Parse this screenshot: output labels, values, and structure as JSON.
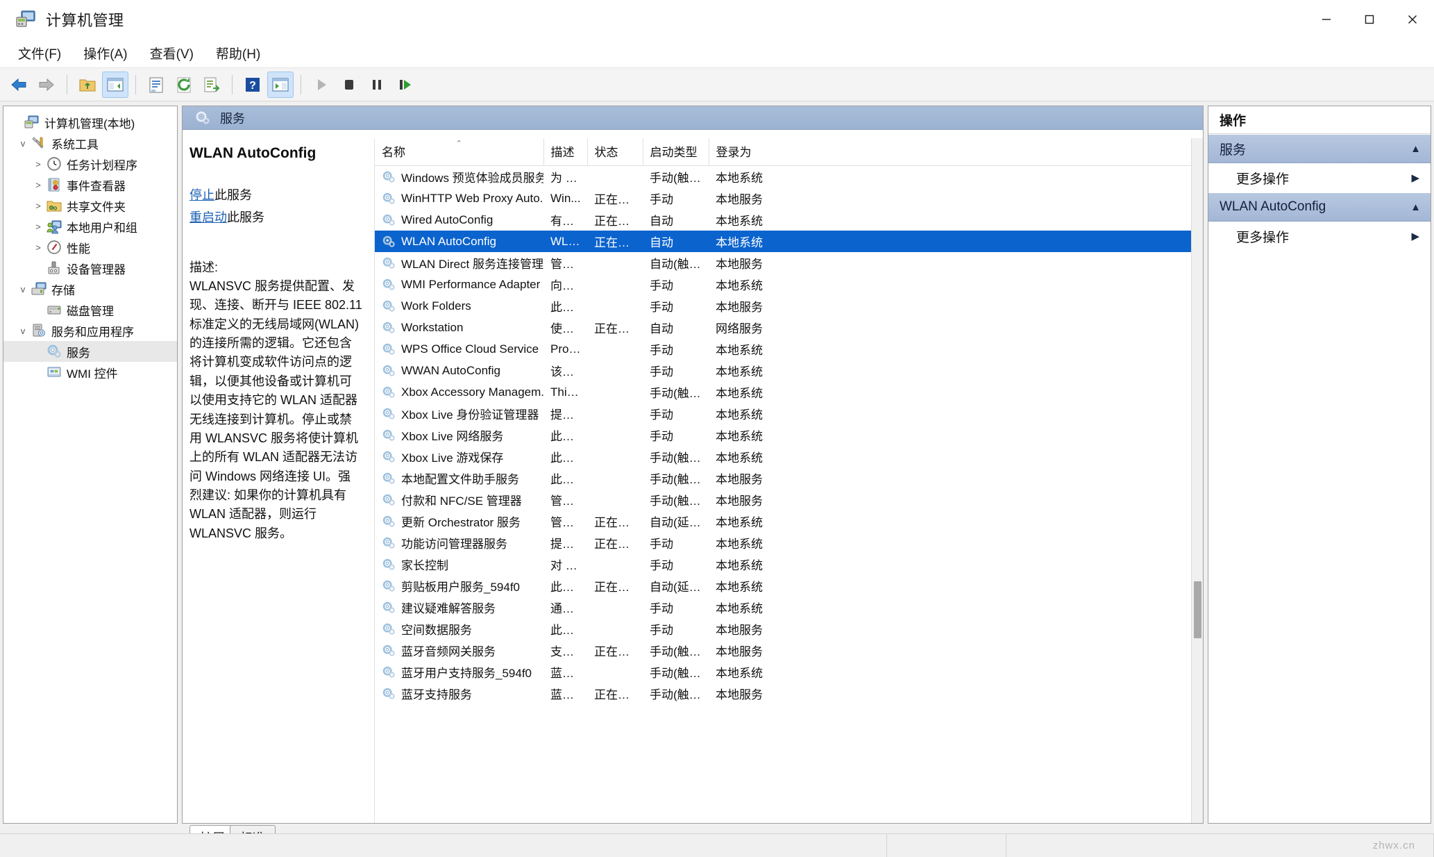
{
  "window": {
    "title": "计算机管理",
    "app_icon": "computer-management-icon",
    "controls": {
      "minimize": "—",
      "maximize": "□",
      "close": "✕"
    }
  },
  "menubar": {
    "items": [
      {
        "label": "文件(F)",
        "name": "menu-file"
      },
      {
        "label": "操作(A)",
        "name": "menu-action"
      },
      {
        "label": "查看(V)",
        "name": "menu-view"
      },
      {
        "label": "帮助(H)",
        "name": "menu-help"
      }
    ]
  },
  "toolbar": {
    "buttons": [
      {
        "name": "back-button",
        "icon": "back-arrow-icon",
        "active": false
      },
      {
        "name": "forward-button",
        "icon": "forward-arrow-icon",
        "active": false
      },
      {
        "name": "up-one-level-button",
        "icon": "folder-up-icon",
        "active": false
      },
      {
        "name": "show-hide-console-tree-button",
        "icon": "console-tree-icon",
        "active": true
      },
      {
        "name": "properties-button",
        "icon": "properties-icon",
        "active": false
      },
      {
        "name": "refresh-button",
        "icon": "refresh-icon",
        "active": false
      },
      {
        "name": "export-list-button",
        "icon": "export-list-icon",
        "active": false
      },
      {
        "name": "help-button",
        "icon": "help-question-icon",
        "active": false
      },
      {
        "name": "show-action-pane-button",
        "icon": "action-pane-icon",
        "active": true
      },
      {
        "name": "start-service-button",
        "icon": "play-icon",
        "active": false
      },
      {
        "name": "stop-service-button",
        "icon": "stop-icon",
        "active": false
      },
      {
        "name": "pause-service-button",
        "icon": "pause-icon",
        "active": false
      },
      {
        "name": "restart-service-button",
        "icon": "restart-icon",
        "active": false
      }
    ]
  },
  "tree": {
    "items": [
      {
        "label": "计算机管理(本地)",
        "indent": 0,
        "chevron": "",
        "icon": "computer-icon",
        "selected": false
      },
      {
        "label": "系统工具",
        "indent": 1,
        "chevron": "v",
        "icon": "tools-icon",
        "selected": false
      },
      {
        "label": "任务计划程序",
        "indent": 2,
        "chevron": ">",
        "icon": "clock-icon",
        "selected": false
      },
      {
        "label": "事件查看器",
        "indent": 2,
        "chevron": ">",
        "icon": "event-viewer-icon",
        "selected": false
      },
      {
        "label": "共享文件夹",
        "indent": 2,
        "chevron": ">",
        "icon": "shared-folder-icon",
        "selected": false
      },
      {
        "label": "本地用户和组",
        "indent": 2,
        "chevron": ">",
        "icon": "users-groups-icon",
        "selected": false
      },
      {
        "label": "性能",
        "indent": 2,
        "chevron": ">",
        "icon": "performance-icon",
        "selected": false
      },
      {
        "label": "设备管理器",
        "indent": 2,
        "chevron": "",
        "icon": "device-manager-icon",
        "selected": false
      },
      {
        "label": "存储",
        "indent": 1,
        "chevron": "v",
        "icon": "storage-icon",
        "selected": false
      },
      {
        "label": "磁盘管理",
        "indent": 2,
        "chevron": "",
        "icon": "disk-management-icon",
        "selected": false
      },
      {
        "label": "服务和应用程序",
        "indent": 1,
        "chevron": "v",
        "icon": "services-apps-icon",
        "selected": false
      },
      {
        "label": "服务",
        "indent": 2,
        "chevron": "",
        "icon": "gear-icon",
        "selected": true
      },
      {
        "label": "WMI 控件",
        "indent": 2,
        "chevron": "",
        "icon": "wmi-control-icon",
        "selected": false
      }
    ]
  },
  "mid": {
    "banner_title": "服务",
    "banner_icon": "gear-icon",
    "detail": {
      "service_name": "WLAN AutoConfig",
      "stop_link": "停止",
      "stop_suffix": "此服务",
      "restart_link": "重启动",
      "restart_suffix": "此服务",
      "description_label": "描述:",
      "description": "WLANSVC 服务提供配置、发现、连接、断开与 IEEE 802.11 标准定义的无线局域网(WLAN)的连接所需的逻辑。它还包含将计算机变成软件访问点的逻辑，以便其他设备或计算机可以使用支持它的 WLAN 适配器无线连接到计算机。停止或禁用 WLANSVC 服务将使计算机上的所有 WLAN 适配器无法访问 Windows 网络连接 UI。强烈建议: 如果你的计算机具有 WLAN 适配器，则运行 WLANSVC 服务。"
    },
    "table": {
      "columns": [
        {
          "label": "名称",
          "name": "column-header-name",
          "sorted": true
        },
        {
          "label": "描述",
          "name": "column-header-description",
          "sorted": false
        },
        {
          "label": "状态",
          "name": "column-header-status",
          "sorted": false
        },
        {
          "label": "启动类型",
          "name": "column-header-startup-type",
          "sorted": false
        },
        {
          "label": "登录为",
          "name": "column-header-log-on-as",
          "sorted": false
        }
      ],
      "sort_caret": "⌃",
      "rows": [
        {
          "name": "Windows 预览体验成员服务",
          "desc": "为 W...",
          "status": "",
          "startup": "手动(触发...",
          "logon": "本地系统",
          "selected": false
        },
        {
          "name": "WinHTTP Web Proxy Auto...",
          "desc": "Win...",
          "status": "正在运...",
          "startup": "手动",
          "logon": "本地服务",
          "selected": false
        },
        {
          "name": "Wired AutoConfig",
          "desc": "有线...",
          "status": "正在运...",
          "startup": "自动",
          "logon": "本地系统",
          "selected": false
        },
        {
          "name": "WLAN AutoConfig",
          "desc": "WLA...",
          "status": "正在运...",
          "startup": "自动",
          "logon": "本地系统",
          "selected": true
        },
        {
          "name": "WLAN Direct 服务连接管理...",
          "desc": "管理...",
          "status": "",
          "startup": "自动(触发...",
          "logon": "本地服务",
          "selected": false
        },
        {
          "name": "WMI Performance Adapter",
          "desc": "向网...",
          "status": "",
          "startup": "手动",
          "logon": "本地系统",
          "selected": false
        },
        {
          "name": "Work Folders",
          "desc": "此服...",
          "status": "",
          "startup": "手动",
          "logon": "本地服务",
          "selected": false
        },
        {
          "name": "Workstation",
          "desc": "使用 ...",
          "status": "正在运...",
          "startup": "自动",
          "logon": "网络服务",
          "selected": false
        },
        {
          "name": "WPS Office Cloud Service",
          "desc": "Provi...",
          "status": "",
          "startup": "手动",
          "logon": "本地系统",
          "selected": false
        },
        {
          "name": "WWAN AutoConfig",
          "desc": "该服...",
          "status": "",
          "startup": "手动",
          "logon": "本地系统",
          "selected": false
        },
        {
          "name": "Xbox Accessory Managem...",
          "desc": "This ...",
          "status": "",
          "startup": "手动(触发...",
          "logon": "本地系统",
          "selected": false
        },
        {
          "name": "Xbox Live 身份验证管理器",
          "desc": "提供...",
          "status": "",
          "startup": "手动",
          "logon": "本地系统",
          "selected": false
        },
        {
          "name": "Xbox Live 网络服务",
          "desc": "此服...",
          "status": "",
          "startup": "手动",
          "logon": "本地系统",
          "selected": false
        },
        {
          "name": "Xbox Live 游戏保存",
          "desc": "此服...",
          "status": "",
          "startup": "手动(触发...",
          "logon": "本地系统",
          "selected": false
        },
        {
          "name": "本地配置文件助手服务",
          "desc": "此服...",
          "status": "",
          "startup": "手动(触发...",
          "logon": "本地服务",
          "selected": false
        },
        {
          "name": "付款和 NFC/SE 管理器",
          "desc": "管理...",
          "status": "",
          "startup": "手动(触发...",
          "logon": "本地服务",
          "selected": false
        },
        {
          "name": "更新 Orchestrator 服务",
          "desc": "管理 ...",
          "status": "正在运...",
          "startup": "自动(延迟...",
          "logon": "本地系统",
          "selected": false
        },
        {
          "name": "功能访问管理器服务",
          "desc": "提供...",
          "status": "正在运...",
          "startup": "手动",
          "logon": "本地系统",
          "selected": false
        },
        {
          "name": "家长控制",
          "desc": "对 W...",
          "status": "",
          "startup": "手动",
          "logon": "本地系统",
          "selected": false
        },
        {
          "name": "剪贴板用户服务_594f0",
          "desc": "此用...",
          "status": "正在运...",
          "startup": "自动(延迟...",
          "logon": "本地系统",
          "selected": false
        },
        {
          "name": "建议疑难解答服务",
          "desc": "通过...",
          "status": "",
          "startup": "手动",
          "logon": "本地系统",
          "selected": false
        },
        {
          "name": "空间数据服务",
          "desc": "此服...",
          "status": "",
          "startup": "手动",
          "logon": "本地服务",
          "selected": false
        },
        {
          "name": "蓝牙音频网关服务",
          "desc": "支持...",
          "status": "正在运...",
          "startup": "手动(触发...",
          "logon": "本地服务",
          "selected": false
        },
        {
          "name": "蓝牙用户支持服务_594f0",
          "desc": "蓝牙...",
          "status": "",
          "startup": "手动(触发...",
          "logon": "本地系统",
          "selected": false
        },
        {
          "name": "蓝牙支持服务",
          "desc": "蓝牙...",
          "status": "正在运...",
          "startup": "手动(触发...",
          "logon": "本地服务",
          "selected": false
        }
      ]
    },
    "tabs": [
      {
        "label": "扩展",
        "name": "tab-extended",
        "active": true
      },
      {
        "label": "标准",
        "name": "tab-standard",
        "active": false
      }
    ]
  },
  "actions": {
    "title": "操作",
    "groups": [
      {
        "header": "服务",
        "name": "actions-group-services",
        "items": [
          {
            "label": "更多操作",
            "name": "action-more-actions-services"
          }
        ]
      },
      {
        "header": "WLAN AutoConfig",
        "name": "actions-group-wlan-autoconfig",
        "items": [
          {
            "label": "更多操作",
            "name": "action-more-actions-wlan"
          }
        ]
      }
    ],
    "collapse_caret": "▲",
    "submenu_caret": "▶"
  },
  "statusbar": {
    "watermark": "zhwx.cn"
  },
  "colors": {
    "selection_blue": "#0b63ce",
    "banner_blue": "#9bb2d2",
    "link_blue": "#1a5fb4",
    "actions_group": "#a3b7d6"
  }
}
